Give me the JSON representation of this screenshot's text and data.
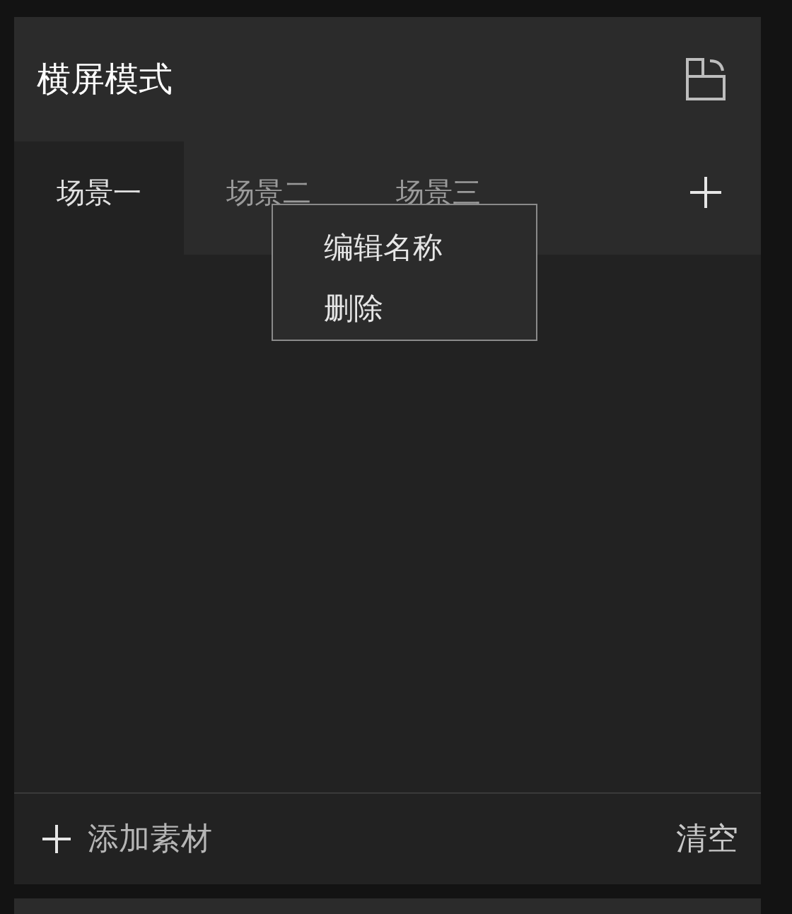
{
  "panel": {
    "title": "横屏模式"
  },
  "tabs": [
    {
      "label": "场景一",
      "selected": true
    },
    {
      "label": "场景二",
      "selected": false
    },
    {
      "label": "场景三",
      "selected": false
    }
  ],
  "context_menu": {
    "items": [
      "编辑名称",
      "删除"
    ]
  },
  "footer": {
    "add_label": "添加素材",
    "clear_label": "清空"
  }
}
